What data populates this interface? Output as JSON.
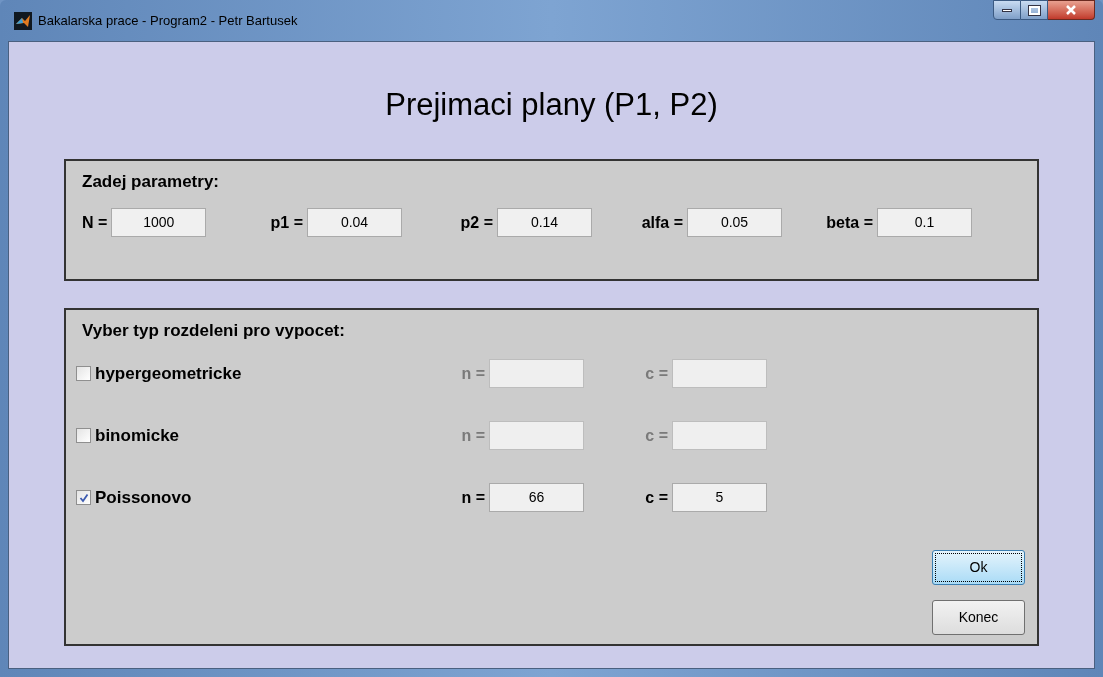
{
  "window": {
    "title": "Bakalarska prace - Program2 - Petr Bartusek"
  },
  "heading": "Prejimaci plany (P1, P2)",
  "parameters": {
    "title": "Zadej parametry:",
    "fields": [
      {
        "label": "N =",
        "value": "1000"
      },
      {
        "label": "p1 =",
        "value": "0.04"
      },
      {
        "label": "p2 =",
        "value": "0.14"
      },
      {
        "label": "alfa =",
        "value": "0.05"
      },
      {
        "label": "beta =",
        "value": "0.1"
      }
    ]
  },
  "distribution": {
    "title": "Vyber typ rozdeleni pro vypocet:",
    "options": [
      {
        "label": "hypergeometricke",
        "checked": false,
        "fields": [
          {
            "label": "n =",
            "disabled": true
          },
          {
            "label": "c =",
            "disabled": true
          }
        ]
      },
      {
        "label": "binomicke",
        "checked": false,
        "fields": [
          {
            "label": "n =",
            "disabled": true
          },
          {
            "label": "c =",
            "disabled": true
          }
        ]
      },
      {
        "label": "Poissonovo",
        "checked": true,
        "fields": [
          {
            "label": "n =",
            "value": "66",
            "disabled": false
          },
          {
            "label": "c =",
            "value": "5",
            "disabled": false
          }
        ]
      }
    ]
  },
  "buttons": [
    {
      "label": "Ok",
      "focused": true
    },
    {
      "label": "Konec",
      "focused": false
    }
  ]
}
